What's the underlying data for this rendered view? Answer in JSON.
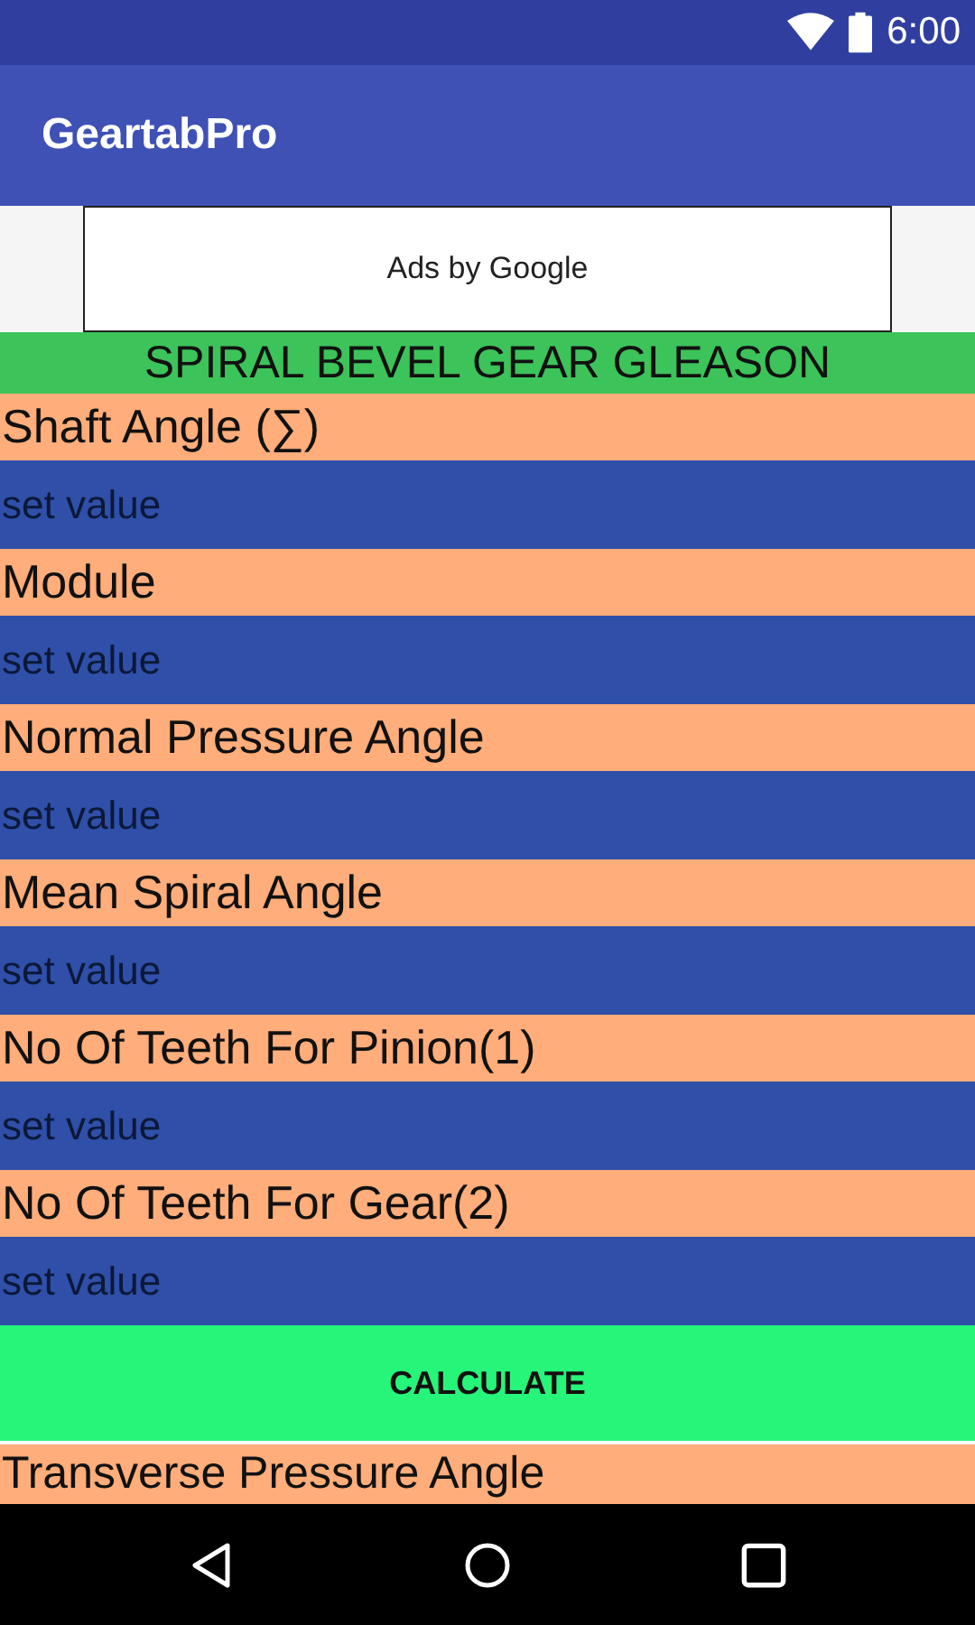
{
  "status_bar": {
    "time": "6:00"
  },
  "app_bar": {
    "title": "GeartabPro"
  },
  "ad": {
    "text": "Ads by Google"
  },
  "section_title": "SPIRAL BEVEL GEAR GLEASON",
  "fields": [
    {
      "label": "Shaft Angle  (∑)",
      "placeholder": "set value"
    },
    {
      "label": "Module",
      "placeholder": "set value"
    },
    {
      "label": "Normal Pressure Angle",
      "placeholder": "set value"
    },
    {
      "label": "Mean Spiral Angle",
      "placeholder": "set value"
    },
    {
      "label": "No Of Teeth For Pinion(1)",
      "placeholder": "set value"
    },
    {
      "label": "No Of Teeth For Gear(2)",
      "placeholder": "set value"
    }
  ],
  "button": "CALCULATE",
  "results": [
    {
      "label": "Transverse Pressure Angle"
    }
  ]
}
